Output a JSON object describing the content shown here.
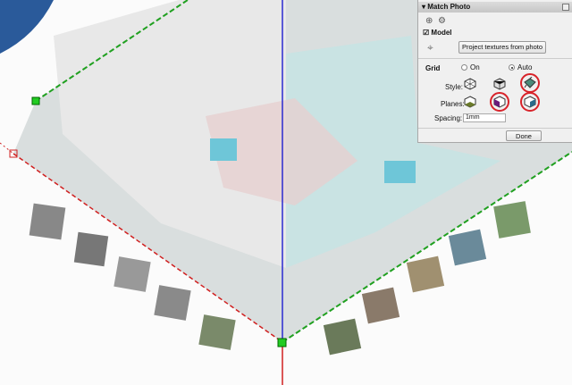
{
  "panel": {
    "title": "Match Photo",
    "model_label": "Model",
    "model_checked": true,
    "project_button": "Project textures from photo",
    "grid_label": "Grid",
    "grid_options": [
      "On",
      "Auto"
    ],
    "grid_selected": "Auto",
    "style_label": "Style:",
    "planes_label": "Planes:",
    "spacing_label": "Spacing:",
    "spacing_value": "1mm",
    "done_button": "Done"
  },
  "colors": {
    "axis_blue": "#2a2ad0",
    "axis_red": "#d02020",
    "axis_green": "#20a020",
    "highlight": "#d8232a"
  }
}
